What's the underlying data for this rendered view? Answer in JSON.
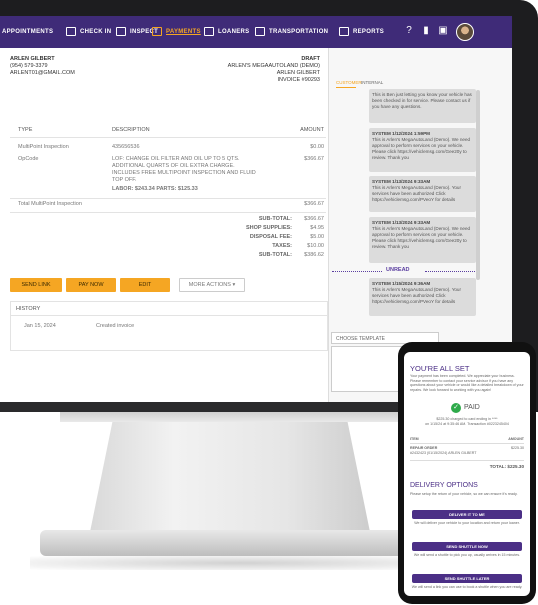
{
  "nav": {
    "items": [
      {
        "label": "APPOINTMENTS"
      },
      {
        "label": "CHECK IN"
      },
      {
        "label": "INSPECT"
      },
      {
        "label": "PAYMENTS"
      },
      {
        "label": "LOANERS"
      },
      {
        "label": "TRANSPORTATION"
      },
      {
        "label": "REPORTS"
      }
    ]
  },
  "customer": {
    "name": "ARLEN GILBERT",
    "phone": "(954) 579-3379",
    "email": "ARLENT01@GMAIL.COM"
  },
  "invoice_meta": {
    "status": "DRAFT",
    "dealer": "ARLEN'S MEGAAUTOLAND (DEMO)",
    "customer": "ARLEN GILBERT",
    "number": "INVOICE #90293"
  },
  "table": {
    "headers": {
      "type": "TYPE",
      "description": "DESCRIPTION",
      "amount": "AMOUNT"
    },
    "rows": [
      {
        "type": "MultiPoint Inspection",
        "description": "435656536",
        "amount": "$0.00"
      },
      {
        "type": "OpCode",
        "description": "LOF: CHANGE OIL FILTER AND OIL UP TO 5 QTS. ADDITIONAL QUARTS OF OIL EXTRA CHARGE. INCLUDES FREE MULTIPOINT INSPECTION AND FLUID TOP OFF.",
        "amount": "$366.67"
      }
    ],
    "labor_parts": "LABOR: $243.34   PARTS: $125.33",
    "total_label": "Total MultiPoint Inspection",
    "total_amount": "$366.67"
  },
  "totals": [
    {
      "label": "SUB-TOTAL:",
      "value": "$366.67"
    },
    {
      "label": "SHOP SUPPLIES:",
      "value": "$4.95"
    },
    {
      "label": "DISPOSAL FEE:",
      "value": "$5.00"
    },
    {
      "label": "TAXES:",
      "value": "$10.00"
    },
    {
      "label": "SUB-TOTAL:",
      "value": "$386.62"
    }
  ],
  "actions": {
    "send_link": "SEND LINK",
    "pay_now": "PAY NOW",
    "edit": "EDIT",
    "more_actions": "MORE ACTIONS"
  },
  "history": {
    "title": "HISTORY",
    "rows": [
      {
        "date": "Jan 15, 2024",
        "event": "Created invoice"
      }
    ]
  },
  "chat": {
    "tabs": [
      "CUSTOMER",
      "INTERNAL"
    ],
    "messages": [
      {
        "header": "",
        "body": "This is Ben just letting you know your vehicle has been checked in for service. Please contact us if you have any questions."
      },
      {
        "header": "SYSTEM 1/12/2024 1:59PM",
        "body": "This is Arlen's MegaAutoLand (Demo). We need approval to perform services on your vehicle. Please click https://vehiclemsg.com/Gee20y to review. Thank you"
      },
      {
        "header": "SYSTEM 1/13/2024 9:33AM",
        "body": "This is Arlen's MegaAutoLand (Demo). Your services have been authorized Click https://vehiclemsg.com/PVeoY for details"
      },
      {
        "header": "SYSTEM 1/13/2024 9:33AM",
        "body": "This is Arlen's MegaAutoLand (Demo). We need approval to perform services on your vehicle. Please click https://vehiclemsg.com/Gee20y to review. Thank you"
      },
      {
        "header": "SYSTEM 1/15/2024 9:36AM",
        "body": "This is Arlen's MegaAutoLand (Demo). Your services have been authorized Click https://vehiclemsg.com/PVeoY for details"
      }
    ],
    "unread": "UNREAD",
    "template_placeholder": "CHOOSE TEMPLATE"
  },
  "phone": {
    "title": "YOU'RE ALL SET",
    "intro": "Your payment has been completed. We appreciate your business. Please remember to contact your service advisor if you have any questions about your vehicle or would like a detailed breakdown of your repairs. We look forward to working with you again!",
    "paid": "PAID",
    "charge_line1": "$225.30 charged to card ending in ****",
    "charge_line2": "on 1/15/24 at 9:35:46 AM. Transaction #0223245404",
    "item_header": "ITEM",
    "amount_header": "AMOUNT",
    "item_name": "REPAIR ORDER",
    "item_detail": "#2432423 (01/15/2024) ARLEN GILBERT",
    "item_amount": "$225.30",
    "total": "TOTAL: $225.30",
    "delivery_title": "DELIVERY OPTIONS",
    "delivery_intro": "Please setup the return of your vehicle, so we can ensure it's ready.",
    "opt1_btn": "DELIVER IT TO ME",
    "opt1_text": "We will deliver your vehicle to your location and return your loaner.",
    "opt2_btn": "SEND SHUTTLE NOW",
    "opt2_text": "We will send a shuttle to pick you up, usually arrives in 15 minutes.",
    "opt3_btn": "SEND SHUTTLE LATER",
    "opt3_text": "We will send a link you can use to book a shuttle when you are ready."
  },
  "colors": {
    "nav": "#3f2b78",
    "accent": "#f5a623",
    "paid": "#2eaa4a",
    "unread": "#5b3fa0"
  }
}
